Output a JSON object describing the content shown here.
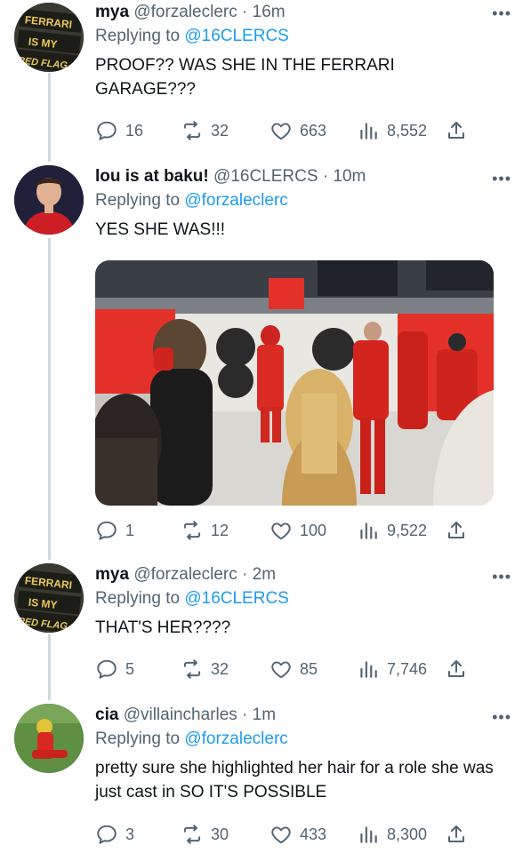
{
  "tweets": [
    {
      "name": "mya",
      "handle": "@forzaleclerc",
      "separator": "·",
      "time": "16m",
      "replying_prefix": "Replying to",
      "replying_to": "@16CLERCS",
      "text": "PROOF?? WAS SHE IN THE FERRARI GARAGE???",
      "replies": "16",
      "retweets": "32",
      "likes": "663",
      "views": "8,552",
      "avatar_text": [
        "FERRARI",
        "IS MY",
        "RED FLAG"
      ]
    },
    {
      "name": "lou is at baku!",
      "handle": "@16CLERCS",
      "separator": "·",
      "time": "10m",
      "replying_prefix": "Replying to",
      "replying_to": "@forzaleclerc",
      "text": "YES SHE WAS!!!",
      "replies": "1",
      "retweets": "12",
      "likes": "100",
      "views": "9,522"
    },
    {
      "name": "mya",
      "handle": "@forzaleclerc",
      "separator": "·",
      "time": "2m",
      "replying_prefix": "Replying to",
      "replying_to": "@16CLERCS",
      "text": "THAT'S HER????",
      "replies": "5",
      "retweets": "32",
      "likes": "85",
      "views": "7,746",
      "avatar_text": [
        "FERRARI",
        "IS MY",
        "RED FLAG"
      ]
    },
    {
      "name": "cia",
      "handle": "@villaincharles",
      "separator": "·",
      "time": "1m",
      "replying_prefix": "Replying to",
      "replying_to": "@forzaleclerc",
      "text": "pretty sure she highlighted her hair for a role she was just cast in SO IT'S POSSIBLE",
      "replies": "3",
      "retweets": "30",
      "likes": "433",
      "views": "8,300"
    }
  ],
  "more_glyph": "•••",
  "colors": {
    "accent": "#1d9bf0",
    "muted": "#536471",
    "text": "#0f1419",
    "thread": "#cfd9de"
  }
}
